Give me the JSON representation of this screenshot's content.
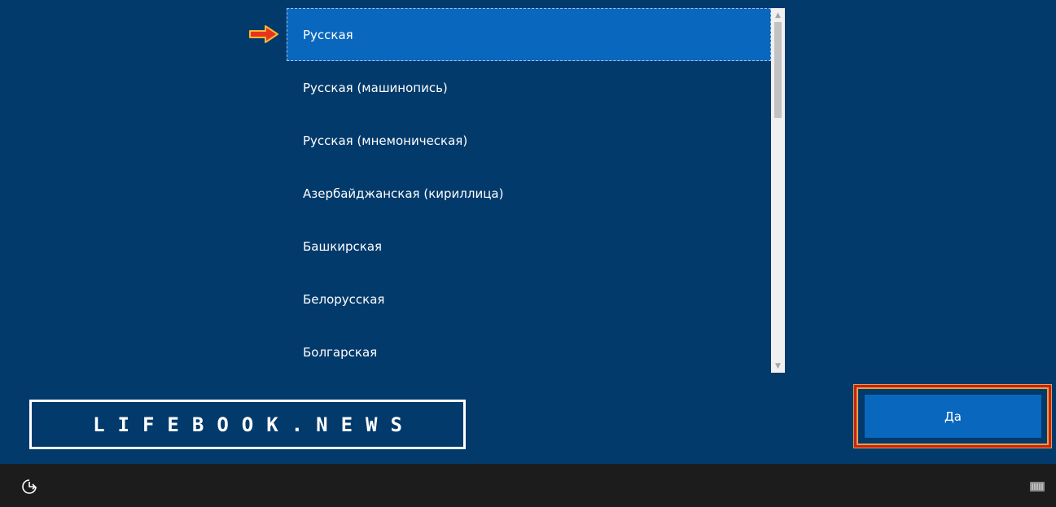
{
  "layout_list": {
    "items": [
      {
        "label": "Русская",
        "selected": true
      },
      {
        "label": "Русская (машинопись)",
        "selected": false
      },
      {
        "label": "Русская (мнемоническая)",
        "selected": false
      },
      {
        "label": "Азербайджанская (кириллица)",
        "selected": false
      },
      {
        "label": "Башкирская",
        "selected": false
      },
      {
        "label": "Белорусская",
        "selected": false
      },
      {
        "label": "Болгарская",
        "selected": false
      }
    ]
  },
  "watermark": {
    "text": "LIFEBOOK.NEWS"
  },
  "footer": {
    "ok_label": "Да"
  },
  "icons": {
    "pointer_arrow": "arrow-right-icon",
    "accessibility": "ease-of-access-icon",
    "keyboard": "keyboard-icon"
  },
  "colors": {
    "background": "#023a6b",
    "selection": "#0a67be",
    "taskbar": "#1c1c1c",
    "highlight_border": "#c7211b",
    "arrow": "#e8331e"
  }
}
